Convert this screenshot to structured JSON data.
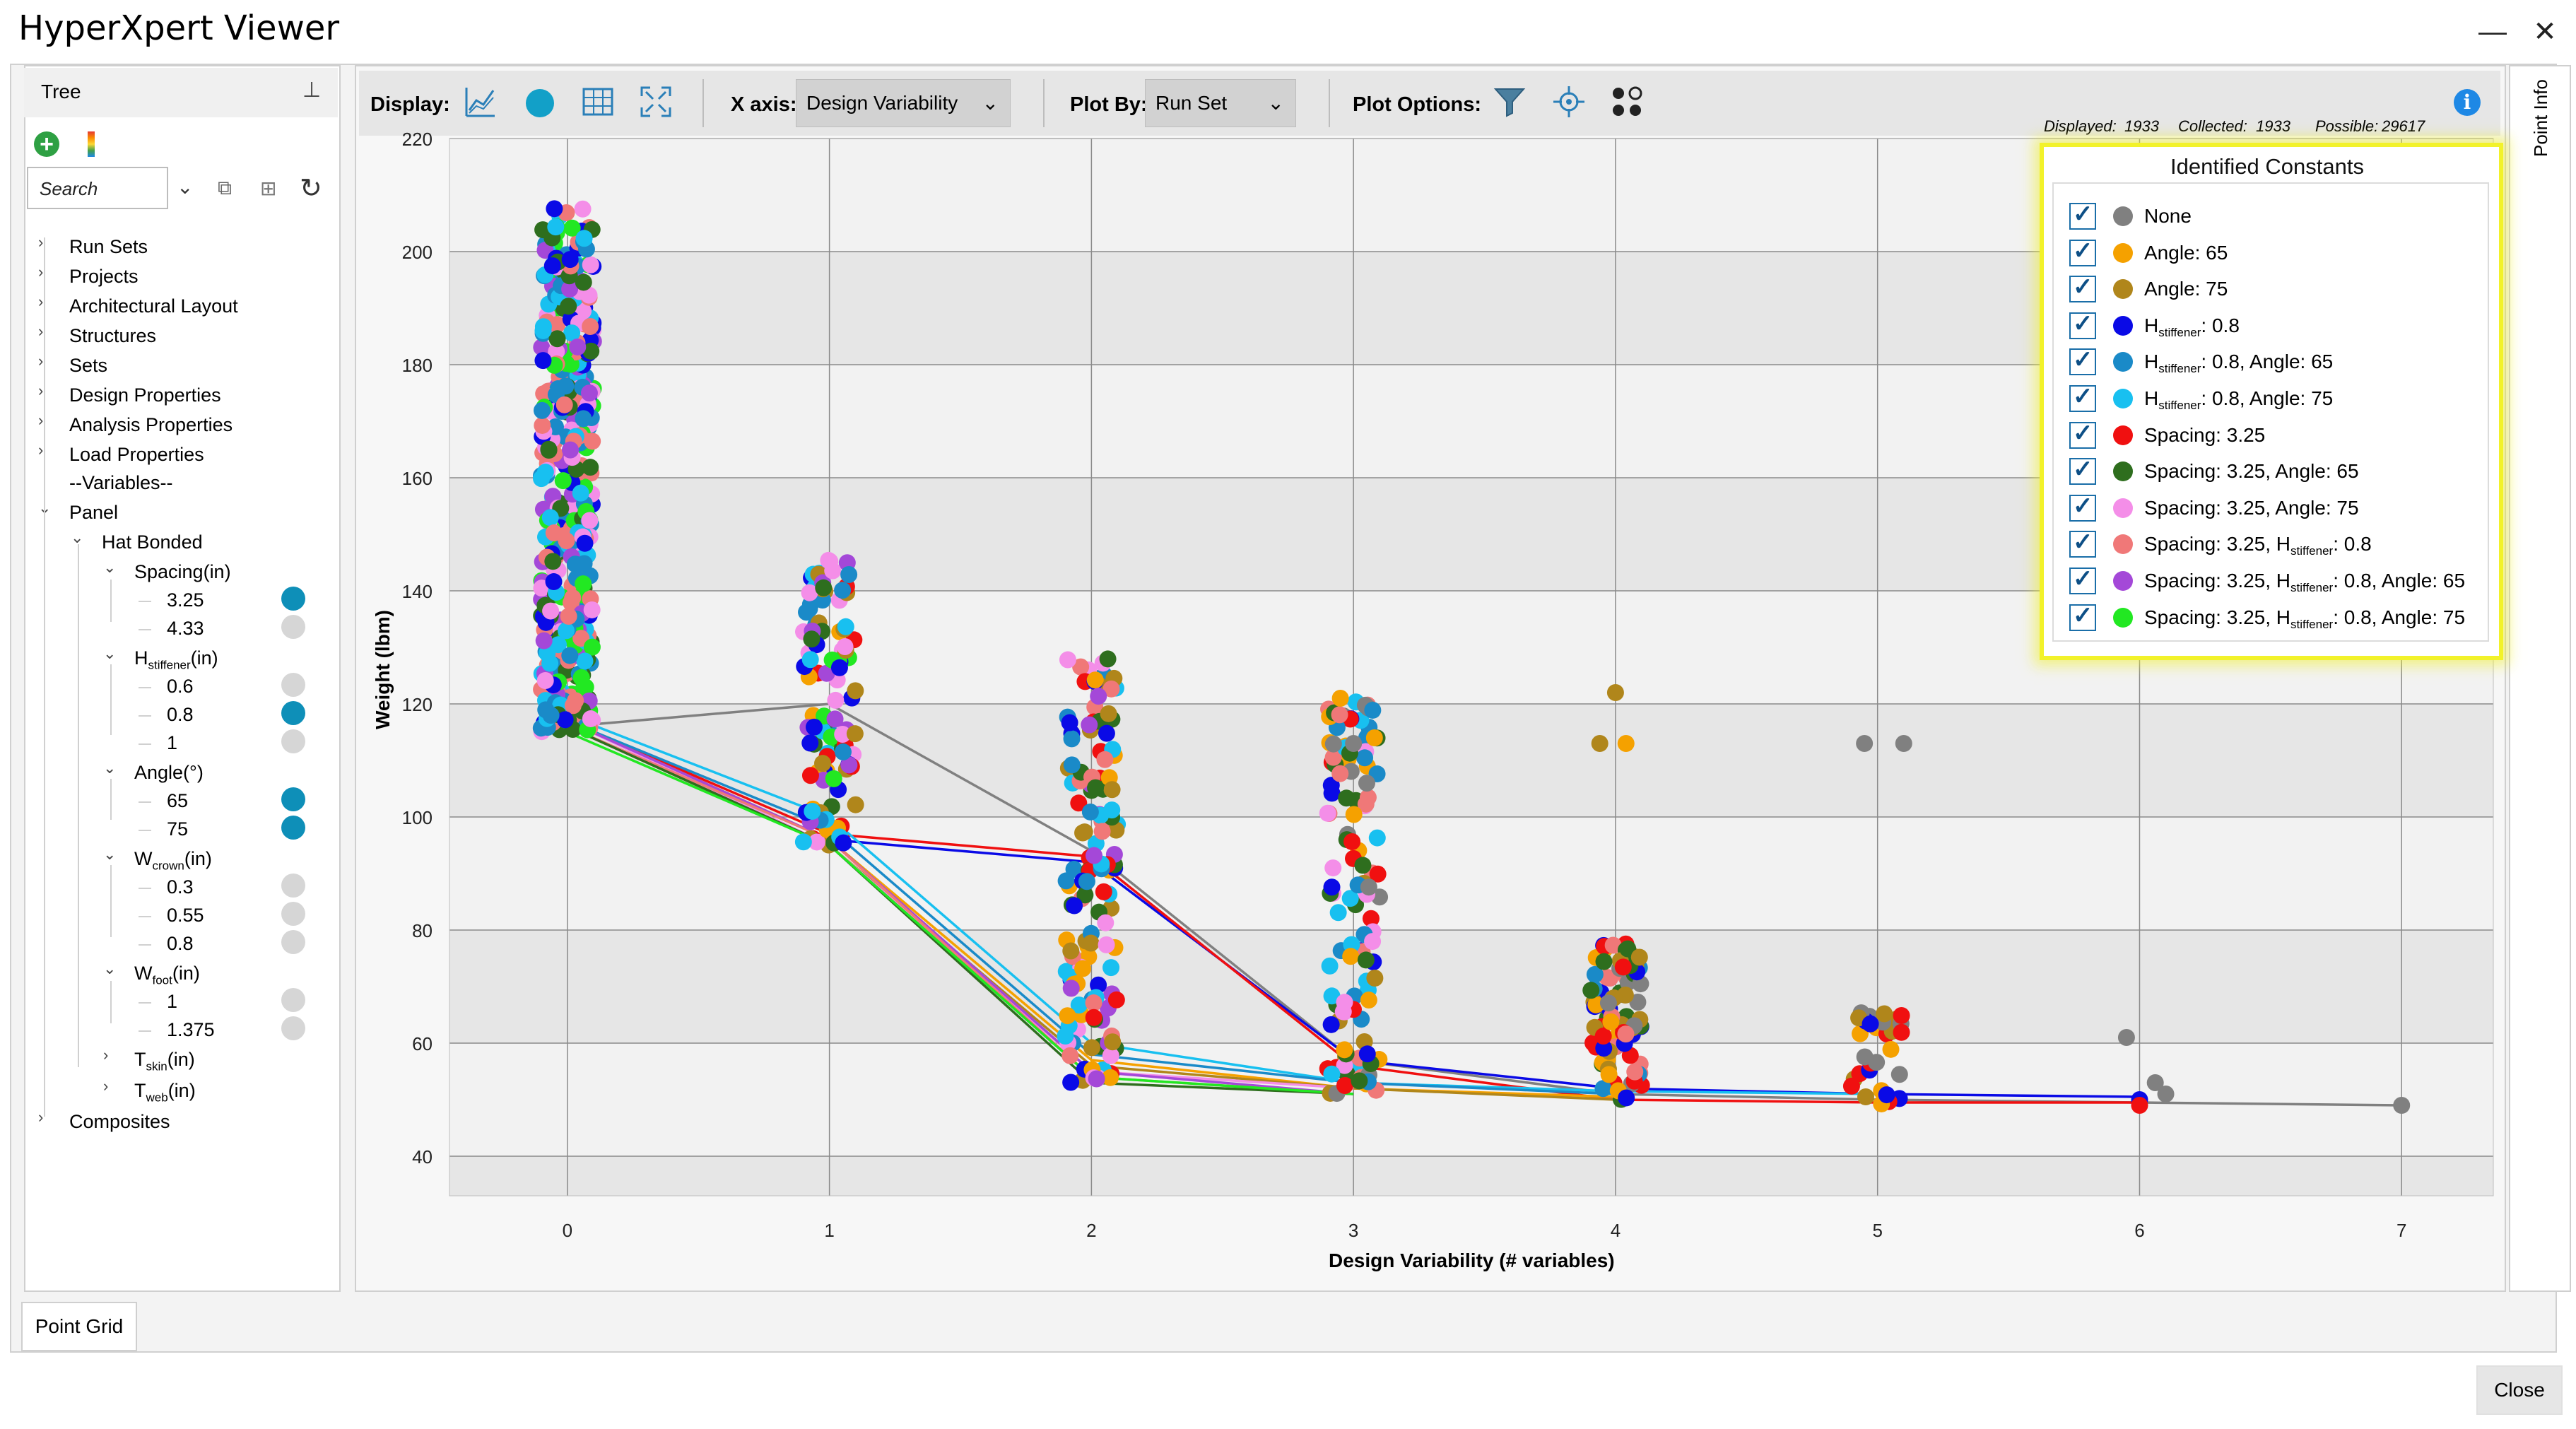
{
  "window": {
    "title": "HyperXpert Viewer",
    "minimize": "—",
    "close": "✕"
  },
  "tree": {
    "title": "Tree",
    "search_placeholder": "Search",
    "items": [
      {
        "label": "Run Sets",
        "caret": "›",
        "level": 0
      },
      {
        "label": "Projects",
        "caret": "›",
        "level": 0
      },
      {
        "label": "Architectural Layout",
        "caret": "›",
        "level": 0
      },
      {
        "label": "Structures",
        "caret": "›",
        "level": 0
      },
      {
        "label": "Sets",
        "caret": "›",
        "level": 0
      },
      {
        "label": "Design Properties",
        "caret": "›",
        "level": 0
      },
      {
        "label": "Analysis Properties",
        "caret": "›",
        "level": 0
      },
      {
        "label": "Load Properties",
        "caret": "›",
        "level": 0
      },
      {
        "label": "--Variables--",
        "caret": "",
        "level": 0
      },
      {
        "label": "Panel",
        "caret": "⌄",
        "level": 0
      },
      {
        "label": "Hat Bonded",
        "caret": "⌄",
        "level": 1
      },
      {
        "label": "Spacing(in)",
        "caret": "⌄",
        "level": 2
      },
      {
        "label": "3.25",
        "caret": "",
        "level": 3,
        "selected": true
      },
      {
        "label": "4.33",
        "caret": "",
        "level": 3,
        "selected": false
      },
      {
        "label": "H",
        "sub": "stiffener",
        "suffix": "(in)",
        "caret": "⌄",
        "level": 2
      },
      {
        "label": "0.6",
        "caret": "",
        "level": 3,
        "selected": false
      },
      {
        "label": "0.8",
        "caret": "",
        "level": 3,
        "selected": true
      },
      {
        "label": "1",
        "caret": "",
        "level": 3,
        "selected": false
      },
      {
        "label": "Angle(°)",
        "caret": "⌄",
        "level": 2
      },
      {
        "label": "65",
        "caret": "",
        "level": 3,
        "selected": true
      },
      {
        "label": "75",
        "caret": "",
        "level": 3,
        "selected": true
      },
      {
        "label": "W",
        "sub": "crown",
        "suffix": "(in)",
        "caret": "⌄",
        "level": 2
      },
      {
        "label": "0.3",
        "caret": "",
        "level": 3,
        "selected": false
      },
      {
        "label": "0.55",
        "caret": "",
        "level": 3,
        "selected": false
      },
      {
        "label": "0.8",
        "caret": "",
        "level": 3,
        "selected": false
      },
      {
        "label": "W",
        "sub": "foot",
        "suffix": "(in)",
        "caret": "⌄",
        "level": 2
      },
      {
        "label": "1",
        "caret": "",
        "level": 3,
        "selected": false
      },
      {
        "label": "1.375",
        "caret": "",
        "level": 3,
        "selected": false
      },
      {
        "label": "T",
        "sub": "skin",
        "suffix": "(in)",
        "caret": "›",
        "level": 2
      },
      {
        "label": "T",
        "sub": "web",
        "suffix": "(in)",
        "caret": "›",
        "level": 2
      },
      {
        "label": "Composites",
        "caret": "›",
        "level": 0
      }
    ]
  },
  "toolbar": {
    "display_label": "Display:",
    "xaxis_label": "X axis:",
    "xaxis_value": "Design Variability",
    "plotby_label": "Plot By:",
    "plotby_value": "Run Set",
    "plotoptions_label": "Plot Options:",
    "info": "i"
  },
  "stats": {
    "displayed_label": "Displayed:",
    "displayed": "1933",
    "collected_label": "Collected:",
    "collected": "1933",
    "possible_label": "Possible:",
    "possible": "29617"
  },
  "side_tab": "Point Info",
  "buttons": {
    "point_grid": "Point Grid",
    "close": "Close"
  },
  "legend": {
    "title": "Identified Constants",
    "items": [
      {
        "parts": [
          "None"
        ],
        "color": "#808080"
      },
      {
        "parts": [
          "Angle: 65"
        ],
        "color": "#f5a100"
      },
      {
        "parts": [
          "Angle: 75"
        ],
        "color": "#b0861b"
      },
      {
        "parts": [
          "H",
          "stiffener",
          ": 0.8"
        ],
        "color": "#0a0ae6"
      },
      {
        "parts": [
          "H",
          "stiffener",
          ": 0.8, Angle: 65"
        ],
        "color": "#1a8ac8"
      },
      {
        "parts": [
          "H",
          "stiffener",
          ": 0.8, Angle: 75"
        ],
        "color": "#18c0f0"
      },
      {
        "parts": [
          "Spacing: 3.25"
        ],
        "color": "#f01010"
      },
      {
        "parts": [
          "Spacing: 3.25, Angle: 65"
        ],
        "color": "#2e6e1e"
      },
      {
        "parts": [
          "Spacing: 3.25, Angle: 75"
        ],
        "color": "#f48ee8"
      },
      {
        "parts": [
          "Spacing: 3.25, H",
          "stiffener",
          ": 0.8"
        ],
        "color": "#f07878"
      },
      {
        "parts": [
          "Spacing: 3.25, H",
          "stiffener",
          ": 0.8, Angle: 65"
        ],
        "color": "#a448d8"
      },
      {
        "parts": [
          "Spacing: 3.25, H",
          "stiffener",
          ": 0.8, Angle: 75"
        ],
        "color": "#22e822"
      }
    ]
  },
  "chart_data": {
    "type": "scatter",
    "xlabel": "Design Variability (# variables)",
    "ylabel": "Weight (lbm)",
    "xlim": [
      -0.45,
      7.35
    ],
    "ylim": [
      33,
      220
    ],
    "xticks": [
      0,
      1,
      2,
      3,
      4,
      5,
      6,
      7
    ],
    "yticks": [
      40,
      60,
      80,
      100,
      120,
      140,
      160,
      180,
      200,
      220
    ],
    "grid": true,
    "legend_position": "top-right",
    "pareto_lines": [
      {
        "color": "#808080",
        "points": [
          [
            0,
            116
          ],
          [
            1,
            120
          ],
          [
            2,
            94
          ],
          [
            3,
            57
          ],
          [
            4,
            51
          ],
          [
            5,
            50
          ],
          [
            6,
            49.5
          ],
          [
            7,
            49
          ]
        ]
      },
      {
        "color": "#0a0ae6",
        "points": [
          [
            0,
            117
          ],
          [
            1,
            96
          ],
          [
            2,
            92
          ],
          [
            3,
            57
          ],
          [
            4,
            52
          ],
          [
            5,
            51
          ],
          [
            6,
            50.5
          ]
        ]
      },
      {
        "color": "#f01010",
        "points": [
          [
            0,
            117
          ],
          [
            1,
            97
          ],
          [
            2,
            93
          ],
          [
            3,
            56
          ],
          [
            4,
            50
          ],
          [
            5,
            49.5
          ],
          [
            6,
            49.5
          ]
        ]
      },
      {
        "color": "#18c0f0",
        "points": [
          [
            0,
            118
          ],
          [
            1,
            100
          ],
          [
            2,
            60
          ],
          [
            3,
            53
          ],
          [
            4,
            51.5
          ],
          [
            5,
            51
          ]
        ]
      },
      {
        "color": "#1a8ac8",
        "points": [
          [
            0,
            117
          ],
          [
            1,
            98
          ],
          [
            2,
            58
          ],
          [
            3,
            53
          ],
          [
            4,
            51
          ]
        ]
      },
      {
        "color": "#f5a100",
        "points": [
          [
            0,
            117
          ],
          [
            1,
            96
          ],
          [
            2,
            57
          ],
          [
            3,
            52
          ],
          [
            4,
            50.5
          ]
        ]
      },
      {
        "color": "#b0861b",
        "points": [
          [
            0,
            116
          ],
          [
            1,
            95
          ],
          [
            2,
            56
          ],
          [
            3,
            52
          ],
          [
            4,
            50
          ]
        ]
      },
      {
        "color": "#f48ee8",
        "points": [
          [
            0,
            117
          ],
          [
            1,
            95
          ],
          [
            2,
            55
          ],
          [
            3,
            52
          ]
        ]
      },
      {
        "color": "#a448d8",
        "points": [
          [
            0,
            117
          ],
          [
            1,
            96
          ],
          [
            2,
            55
          ],
          [
            3,
            51
          ]
        ]
      },
      {
        "color": "#f07878",
        "points": [
          [
            0,
            116
          ],
          [
            1,
            96
          ],
          [
            2,
            54
          ],
          [
            3,
            51
          ]
        ]
      },
      {
        "color": "#2e6e1e",
        "points": [
          [
            0,
            116
          ],
          [
            1,
            95
          ],
          [
            2,
            53
          ],
          [
            3,
            51
          ]
        ]
      },
      {
        "color": "#22e822",
        "points": [
          [
            0,
            115
          ],
          [
            1,
            95
          ],
          [
            2,
            54
          ],
          [
            3,
            51
          ]
        ]
      }
    ],
    "clusters": [
      {
        "x": 0,
        "spread": 0.1,
        "n": 420,
        "ymin": 115,
        "ymax": 208,
        "colors": [
          "#1a8ac8",
          "#18c0f0",
          "#a448d8",
          "#f48ee8",
          "#2e6e1e",
          "#22e822",
          "#0a0ae6",
          "#f07878"
        ]
      },
      {
        "x": 1,
        "spread": 0.1,
        "n": 110,
        "ymin": 95,
        "ymax": 146,
        "colors": [
          "#1a8ac8",
          "#18c0f0",
          "#a448d8",
          "#f48ee8",
          "#2e6e1e",
          "#22e822",
          "#f5a100",
          "#b0861b",
          "#0a0ae6",
          "#f01010"
        ]
      },
      {
        "x": 2,
        "spread": 0.1,
        "n": 140,
        "ymin": 53,
        "ymax": 129,
        "colors": [
          "#f5a100",
          "#b0861b",
          "#2e6e1e",
          "#1a8ac8",
          "#18c0f0",
          "#f01010",
          "#a448d8",
          "#f48ee8",
          "#f07878",
          "#0a0ae6"
        ]
      },
      {
        "x": 3,
        "spread": 0.1,
        "n": 120,
        "ymin": 51,
        "ymax": 121,
        "colors": [
          "#808080",
          "#f5a100",
          "#b0861b",
          "#f01010",
          "#0a0ae6",
          "#1a8ac8",
          "#18c0f0",
          "#f07878",
          "#f48ee8",
          "#2e6e1e"
        ]
      },
      {
        "x": 4,
        "spread": 0.1,
        "n": 90,
        "ymin": 50,
        "ymax": 78,
        "colors": [
          "#808080",
          "#f5a100",
          "#b0861b",
          "#0a0ae6",
          "#f01010",
          "#1a8ac8",
          "#f07878",
          "#2e6e1e"
        ]
      },
      {
        "x": 5,
        "spread": 0.1,
        "n": 30,
        "ymin": 49,
        "ymax": 66,
        "colors": [
          "#808080",
          "#f5a100",
          "#0a0ae6",
          "#f01010",
          "#b0861b"
        ]
      }
    ],
    "outliers": [
      {
        "x": 4.0,
        "y": 122,
        "color": "#b0861b"
      },
      {
        "x": 3.94,
        "y": 113,
        "color": "#b0861b"
      },
      {
        "x": 4.04,
        "y": 113,
        "color": "#f5a100"
      },
      {
        "x": 2.95,
        "y": 121,
        "color": "#f5a100"
      },
      {
        "x": 3.0,
        "y": 113,
        "color": "#808080"
      },
      {
        "x": 3.08,
        "y": 114,
        "color": "#f5a100"
      },
      {
        "x": 4.95,
        "y": 113,
        "color": "#808080"
      },
      {
        "x": 5.1,
        "y": 113,
        "color": "#808080"
      },
      {
        "x": 5.95,
        "y": 61,
        "color": "#808080"
      },
      {
        "x": 6.0,
        "y": 50,
        "color": "#0a0ae6"
      },
      {
        "x": 6.0,
        "y": 49,
        "color": "#f01010"
      },
      {
        "x": 6.06,
        "y": 53,
        "color": "#808080"
      },
      {
        "x": 6.1,
        "y": 51,
        "color": "#808080"
      },
      {
        "x": 7.0,
        "y": 49,
        "color": "#808080"
      }
    ]
  }
}
